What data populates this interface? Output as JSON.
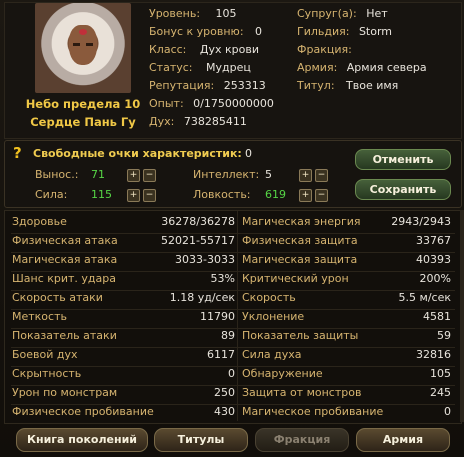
{
  "character": {
    "name_line1": "Небо предела 10",
    "name_line2": "Сердце Пань Гу"
  },
  "info_left": [
    {
      "label": "Уровень:",
      "value": "105"
    },
    {
      "label": "Бонус к уровню:",
      "value": "0"
    },
    {
      "label": "Класс:",
      "value": "Дух крови"
    },
    {
      "label": "Статус:",
      "value": "Мудрец"
    },
    {
      "label": "Репутация:",
      "value": "253313"
    },
    {
      "label": "Опыт:",
      "value": "0/1750000000"
    },
    {
      "label": "Дух:",
      "value": "738285411"
    }
  ],
  "info_right": [
    {
      "label": "Супруг(а):",
      "value": "Нет"
    },
    {
      "label": "Гильдия:",
      "value": "Storm"
    },
    {
      "label": "Фракция:",
      "value": ""
    },
    {
      "label": "Армия:",
      "value": "Армия севера"
    },
    {
      "label": "Титул:",
      "value": "Твое имя"
    }
  ],
  "points": {
    "title": "Свободные очки характеристик:",
    "total": "0",
    "stats": [
      {
        "label": "Вынос.:",
        "value": "71"
      },
      {
        "label": "Интеллект:",
        "value": "5"
      },
      {
        "label": "Сила:",
        "value": "115"
      },
      {
        "label": "Ловкость:",
        "value": "619"
      }
    ],
    "plus": "+",
    "minus": "−",
    "cancel_label": "Отменить",
    "save_label": "Сохранить"
  },
  "stats": [
    [
      "Здоровье",
      "36278/36278",
      "Магическая энергия",
      "2943/2943"
    ],
    [
      "Физическая атака",
      "52021-55717",
      "Физическая защита",
      "33767"
    ],
    [
      "Магическая атака",
      "3033-3033",
      "Магическая защита",
      "40393"
    ],
    [
      "Шанс крит. удара",
      "53%",
      "Критический урон",
      "200%"
    ],
    [
      "Скорость атаки",
      "1.18 уд/сек",
      "Скорость",
      "5.5 м/сек"
    ],
    [
      "Меткость",
      "11790",
      "Уклонение",
      "4581"
    ],
    [
      "Показатель атаки",
      "89",
      "Показатель защиты",
      "59"
    ],
    [
      "Боевой дух",
      "6117",
      "Сила духа",
      "32816"
    ],
    [
      "Скрытность",
      "0",
      "Обнаружение",
      "105"
    ],
    [
      "Урон по монстрам",
      "250",
      "Защита от монстров",
      "245"
    ],
    [
      "Физическое пробивание",
      "430",
      "Магическое пробивание",
      "0"
    ]
  ],
  "tabs": [
    {
      "label": "Книга поколений",
      "enabled": true
    },
    {
      "label": "Титулы",
      "enabled": true
    },
    {
      "label": "Фракция",
      "enabled": false
    },
    {
      "label": "Армия",
      "enabled": true
    }
  ],
  "icons": {
    "question": "question-icon",
    "plus": "plus-icon",
    "minus": "minus-icon"
  },
  "colors": {
    "label_gold": "#d6b470",
    "value_white": "#e8e4dc",
    "value_green": "#56d646",
    "name_gold": "#f0c846"
  }
}
